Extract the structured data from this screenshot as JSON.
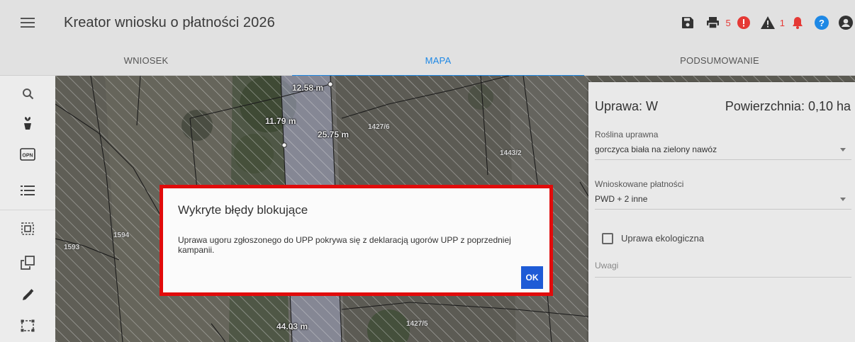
{
  "app": {
    "title": "Kreator wniosku o płatności 2026"
  },
  "header_actions": {
    "errors_count": "5",
    "warnings_count": "1"
  },
  "tabs": [
    {
      "label": "WNIOSEK",
      "active": false
    },
    {
      "label": "MAPA",
      "active": true
    },
    {
      "label": "PODSUMOWANIE",
      "active": false
    }
  ],
  "toolbar": {
    "opn_label": "OPN"
  },
  "map": {
    "measures": [
      "12.58 m",
      "11.79 m",
      "25.75 m",
      "44.03 m"
    ],
    "parcels": [
      "1427/6",
      "1443/2",
      "1594",
      "1593",
      "1427/5"
    ]
  },
  "panel": {
    "crop_label": "Uprawa: W",
    "area_label": "Powierzchnia: 0,10 ha",
    "plant_field_label": "Roślina uprawna",
    "plant_field_value": "gorczyca biała na zielony nawóz",
    "payments_field_label": "Wnioskowane płatności",
    "payments_field_value": "PWD + 2 inne",
    "eco_label": "Uprawa ekologiczna",
    "notes_placeholder": "Uwagi"
  },
  "modal": {
    "title": "Wykryte błędy blokujące",
    "message": "Uprawa ugoru zgłoszonego do UPP pokrywa się z deklaracją ugorów UPP z poprzedniej kampanii.",
    "ok_label": "OK"
  },
  "colors": {
    "accent": "#1e88e5",
    "error": "#e53935",
    "modal_border": "#e10b0b",
    "ok_button": "#1e5bd6"
  }
}
